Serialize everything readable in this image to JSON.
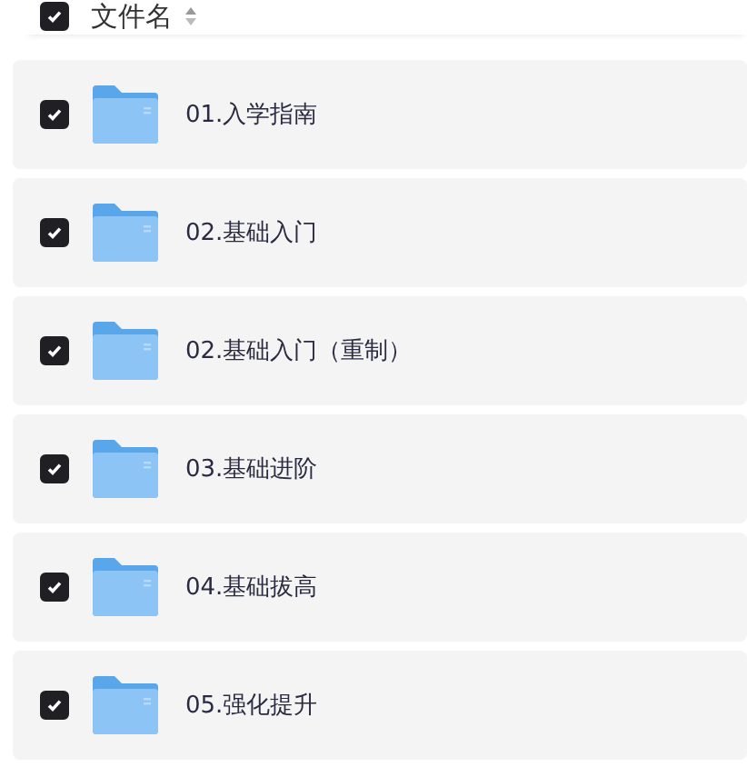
{
  "header": {
    "label": "文件名",
    "checked": true
  },
  "files": [
    {
      "name": "01.入学指南",
      "checked": true
    },
    {
      "name": "02.基础入门",
      "checked": true
    },
    {
      "name": "02.基础入门（重制）",
      "checked": true
    },
    {
      "name": "03.基础进阶",
      "checked": true
    },
    {
      "name": "04.基础拔高",
      "checked": true
    },
    {
      "name": "05.强化提升",
      "checked": true
    }
  ]
}
